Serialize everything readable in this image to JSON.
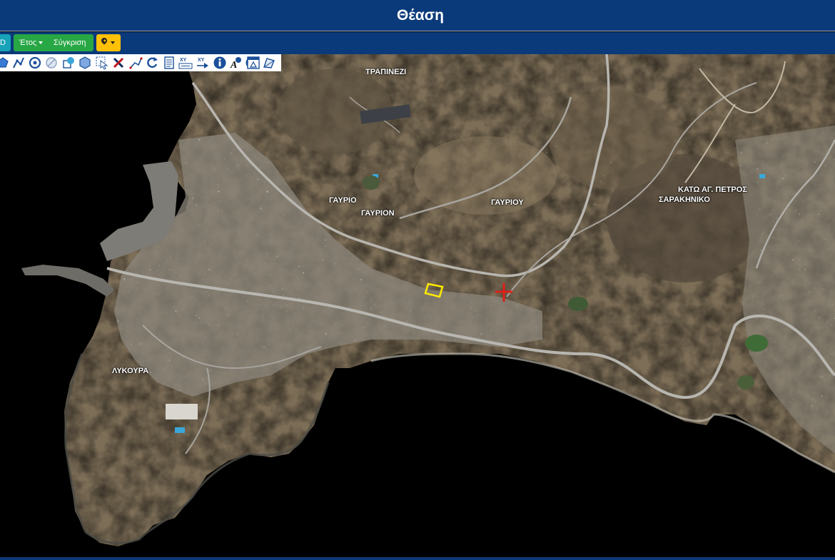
{
  "header": {
    "title": "Θέαση"
  },
  "toolbar": {
    "btn_3d_label": "D",
    "year_label": "Έτος",
    "compare_label": "Σύγκριση",
    "location_icon": "map-marker-icon",
    "colors": {
      "bar": "#0b3a7a",
      "info": "#17a2b8",
      "success": "#28a745",
      "warning": "#ffc107"
    }
  },
  "map_tools": [
    "polygon-icon",
    "polyline-icon",
    "circle-target-icon",
    "circle-slash-icon",
    "shape-fill-icon",
    "hexagon-icon",
    "select-arrow-icon",
    "delete-x-icon",
    "measure-line-icon",
    "refresh-icon",
    "document-icon",
    "xy-coordinates-icon",
    "xy-goto-icon",
    "info-icon",
    "info-a-icon",
    "print-icon",
    "area-polygon-icon"
  ],
  "map": {
    "labels": {
      "trapinezi": "ΤΡΑΠΙΝΕΖΙ",
      "gavrio": "ΓΑΥΡΙΟ",
      "gavrion": "ΓΑΥΡΙΟΝ",
      "gavriou": "ΓΑΥΡΙΟΥ",
      "kato_ag_petros": "ΚΑΤΩ ΑΓ. ΠΕΤΡΟΣ",
      "sarakiniko": "ΣΑΡΑΚΗΝΙΚΟ",
      "lykoura": "ΛΥΚΟΥΡΑ"
    },
    "markers": {
      "parcel_color": "#ffea00",
      "crosshair_color": "#e0201a"
    }
  }
}
